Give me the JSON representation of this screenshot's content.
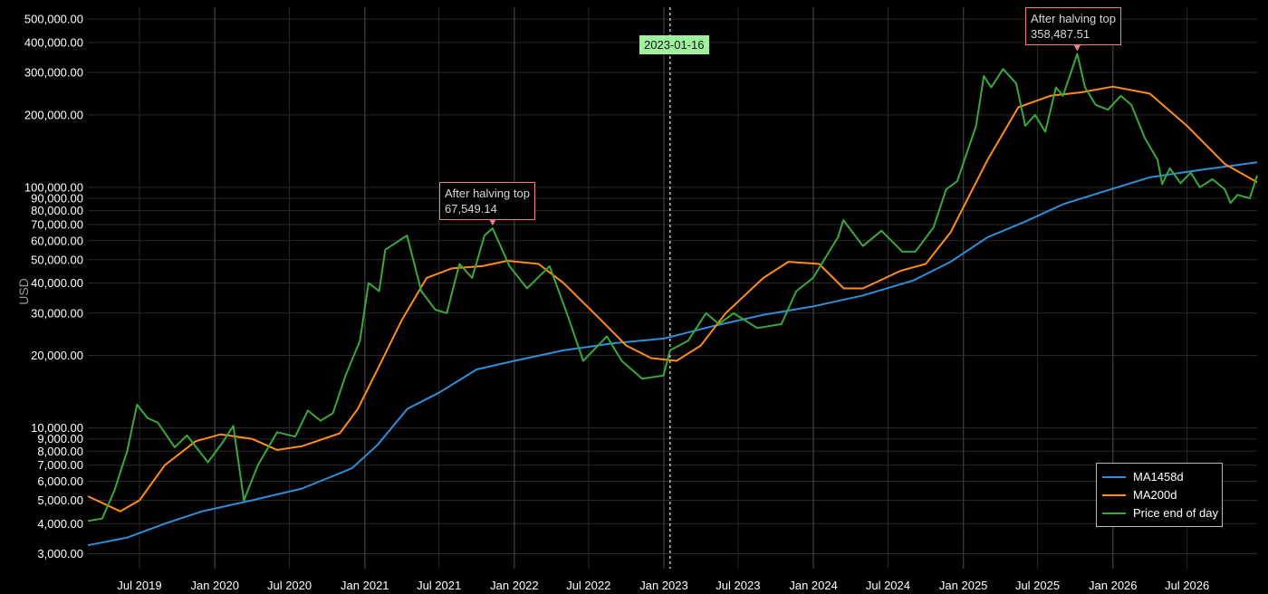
{
  "chart_data": {
    "type": "line",
    "ylabel": "USD",
    "yscale": "log",
    "ylim": [
      2600,
      560000
    ],
    "xlim": [
      "2019-02-25",
      "2026-12-19"
    ],
    "y_ticks": [
      "3,000.00",
      "4,000.00",
      "5,000.00",
      "6,000.00",
      "7,000.00",
      "8,000.00",
      "9,000.00",
      "10,000.00",
      "20,000.00",
      "30,000.00",
      "40,000.00",
      "50,000.00",
      "60,000.00",
      "70,000.00",
      "80,000.00",
      "90,000.00",
      "100,000.00",
      "200,000.00",
      "300,000.00",
      "400,000.00",
      "500,000.00"
    ],
    "x_ticks": [
      "Jul 2019",
      "Jan 2020",
      "Jul 2020",
      "Jan 2021",
      "Jul 2021",
      "Jan 2022",
      "Jul 2022",
      "Jan 2023",
      "Jul 2023",
      "Jan 2024",
      "Jul 2024",
      "Jan 2025",
      "Jul 2025",
      "Jan 2026",
      "Jul 2026"
    ],
    "grid": true,
    "legend_position": "bottom-right",
    "marker": {
      "date": "2023-01-16",
      "label": "2023-01-16",
      "color": "#9ef29e"
    },
    "annotations": [
      {
        "title": "After halving top",
        "value": "67,549.14",
        "date": "2021-11-09",
        "y": 67549.14
      },
      {
        "title": "After halving top",
        "value": "358,487.51",
        "date": "2025-10-06",
        "y": 358487.51
      }
    ],
    "series": [
      {
        "name": "MA1458d",
        "color": "#2f8fd8",
        "points": [
          [
            "2019-02-25",
            3250
          ],
          [
            "2019-06-01",
            3500
          ],
          [
            "2019-09-01",
            4000
          ],
          [
            "2019-12-01",
            4500
          ],
          [
            "2020-04-01",
            5000
          ],
          [
            "2020-08-01",
            5600
          ],
          [
            "2020-12-01",
            6800
          ],
          [
            "2021-02-01",
            8500
          ],
          [
            "2021-04-15",
            12000
          ],
          [
            "2021-07-01",
            14000
          ],
          [
            "2021-10-01",
            17500
          ],
          [
            "2022-01-01",
            19000
          ],
          [
            "2022-05-01",
            21000
          ],
          [
            "2022-09-01",
            22500
          ],
          [
            "2023-01-01",
            23500
          ],
          [
            "2023-05-01",
            26500
          ],
          [
            "2023-09-01",
            29500
          ],
          [
            "2024-01-01",
            32000
          ],
          [
            "2024-05-01",
            35500
          ],
          [
            "2024-09-01",
            41000
          ],
          [
            "2024-12-01",
            49000
          ],
          [
            "2025-03-01",
            62000
          ],
          [
            "2025-06-01",
            72000
          ],
          [
            "2025-09-01",
            85000
          ],
          [
            "2025-12-01",
            95000
          ],
          [
            "2026-04-01",
            110000
          ],
          [
            "2026-08-01",
            118000
          ],
          [
            "2026-12-19",
            127000
          ]
        ]
      },
      {
        "name": "MA200d",
        "color": "#ff8c1a",
        "points": [
          [
            "2019-02-25",
            5200
          ],
          [
            "2019-05-15",
            4500
          ],
          [
            "2019-07-01",
            5000
          ],
          [
            "2019-09-01",
            7000
          ],
          [
            "2019-11-15",
            8800
          ],
          [
            "2020-01-15",
            9400
          ],
          [
            "2020-04-01",
            9000
          ],
          [
            "2020-06-01",
            8100
          ],
          [
            "2020-08-01",
            8400
          ],
          [
            "2020-11-01",
            9500
          ],
          [
            "2020-12-15",
            12000
          ],
          [
            "2021-02-01",
            17500
          ],
          [
            "2021-04-01",
            28000
          ],
          [
            "2021-06-01",
            42000
          ],
          [
            "2021-08-01",
            46000
          ],
          [
            "2021-10-15",
            47000
          ],
          [
            "2021-12-15",
            49500
          ],
          [
            "2022-03-01",
            48000
          ],
          [
            "2022-05-01",
            40000
          ],
          [
            "2022-08-01",
            28000
          ],
          [
            "2022-10-01",
            22000
          ],
          [
            "2022-12-01",
            19500
          ],
          [
            "2023-02-01",
            19000
          ],
          [
            "2023-04-01",
            22000
          ],
          [
            "2023-06-01",
            30000
          ],
          [
            "2023-09-01",
            42000
          ],
          [
            "2023-11-01",
            49000
          ],
          [
            "2024-01-15",
            48000
          ],
          [
            "2024-03-15",
            38000
          ],
          [
            "2024-05-01",
            38000
          ],
          [
            "2024-08-01",
            45000
          ],
          [
            "2024-10-01",
            48000
          ],
          [
            "2024-12-01",
            65000
          ],
          [
            "2025-03-01",
            130000
          ],
          [
            "2025-05-15",
            215000
          ],
          [
            "2025-08-01",
            240000
          ],
          [
            "2025-10-15",
            248000
          ],
          [
            "2026-01-01",
            262000
          ],
          [
            "2026-04-01",
            245000
          ],
          [
            "2026-07-01",
            180000
          ],
          [
            "2026-10-01",
            125000
          ],
          [
            "2026-12-19",
            105000
          ]
        ]
      },
      {
        "name": "Price end of day",
        "color": "#3aa83a",
        "points": [
          [
            "2019-02-25",
            4100
          ],
          [
            "2019-04-01",
            4200
          ],
          [
            "2019-05-01",
            5500
          ],
          [
            "2019-06-01",
            8000
          ],
          [
            "2019-06-25",
            12500
          ],
          [
            "2019-07-20",
            11000
          ],
          [
            "2019-08-15",
            10500
          ],
          [
            "2019-09-25",
            8300
          ],
          [
            "2019-10-25",
            9300
          ],
          [
            "2019-12-15",
            7200
          ],
          [
            "2020-01-20",
            8700
          ],
          [
            "2020-02-15",
            10200
          ],
          [
            "2020-03-12",
            5000
          ],
          [
            "2020-04-15",
            7000
          ],
          [
            "2020-06-01",
            9600
          ],
          [
            "2020-07-15",
            9200
          ],
          [
            "2020-08-15",
            11800
          ],
          [
            "2020-09-15",
            10700
          ],
          [
            "2020-10-15",
            11500
          ],
          [
            "2020-11-15",
            16500
          ],
          [
            "2020-12-20",
            23000
          ],
          [
            "2021-01-10",
            40000
          ],
          [
            "2021-02-05",
            37000
          ],
          [
            "2021-02-20",
            55000
          ],
          [
            "2021-04-14",
            63000
          ],
          [
            "2021-05-19",
            37000
          ],
          [
            "2021-06-22",
            31000
          ],
          [
            "2021-07-20",
            30000
          ],
          [
            "2021-08-20",
            48000
          ],
          [
            "2021-09-20",
            42000
          ],
          [
            "2021-10-20",
            63000
          ],
          [
            "2021-11-09",
            67549
          ],
          [
            "2021-12-20",
            47000
          ],
          [
            "2022-02-01",
            38000
          ],
          [
            "2022-03-28",
            47000
          ],
          [
            "2022-05-12",
            29000
          ],
          [
            "2022-06-18",
            19000
          ],
          [
            "2022-08-15",
            24000
          ],
          [
            "2022-09-20",
            19000
          ],
          [
            "2022-11-09",
            16000
          ],
          [
            "2022-12-31",
            16500
          ],
          [
            "2023-01-16",
            21000
          ],
          [
            "2023-03-01",
            23000
          ],
          [
            "2023-04-14",
            30000
          ],
          [
            "2023-05-15",
            27000
          ],
          [
            "2023-06-20",
            30000
          ],
          [
            "2023-08-17",
            26000
          ],
          [
            "2023-10-15",
            27000
          ],
          [
            "2023-11-20",
            37000
          ],
          [
            "2023-12-31",
            42000
          ],
          [
            "2024-03-01",
            62000
          ],
          [
            "2024-03-14",
            73000
          ],
          [
            "2024-05-01",
            57000
          ],
          [
            "2024-06-15",
            66000
          ],
          [
            "2024-08-05",
            54000
          ],
          [
            "2024-09-06",
            54000
          ],
          [
            "2024-10-20",
            68000
          ],
          [
            "2024-11-20",
            98000
          ],
          [
            "2024-12-17",
            106000
          ],
          [
            "2025-02-01",
            180000
          ],
          [
            "2025-02-20",
            290000
          ],
          [
            "2025-03-10",
            260000
          ],
          [
            "2025-04-08",
            310000
          ],
          [
            "2025-05-10",
            270000
          ],
          [
            "2025-06-01",
            180000
          ],
          [
            "2025-06-25",
            200000
          ],
          [
            "2025-07-20",
            170000
          ],
          [
            "2025-08-15",
            260000
          ],
          [
            "2025-09-01",
            240000
          ],
          [
            "2025-10-06",
            358487
          ],
          [
            "2025-10-25",
            260000
          ],
          [
            "2025-11-20",
            220000
          ],
          [
            "2025-12-20",
            210000
          ],
          [
            "2026-01-20",
            240000
          ],
          [
            "2026-02-15",
            220000
          ],
          [
            "2026-03-20",
            160000
          ],
          [
            "2026-04-20",
            130000
          ],
          [
            "2026-05-01",
            103000
          ],
          [
            "2026-05-20",
            120000
          ],
          [
            "2026-06-15",
            104000
          ],
          [
            "2026-07-10",
            115000
          ],
          [
            "2026-08-01",
            100000
          ],
          [
            "2026-09-01",
            108000
          ],
          [
            "2026-10-01",
            98000
          ],
          [
            "2026-10-15",
            86000
          ],
          [
            "2026-11-01",
            93000
          ],
          [
            "2026-12-01",
            90000
          ],
          [
            "2026-12-19",
            112000
          ]
        ]
      }
    ]
  }
}
